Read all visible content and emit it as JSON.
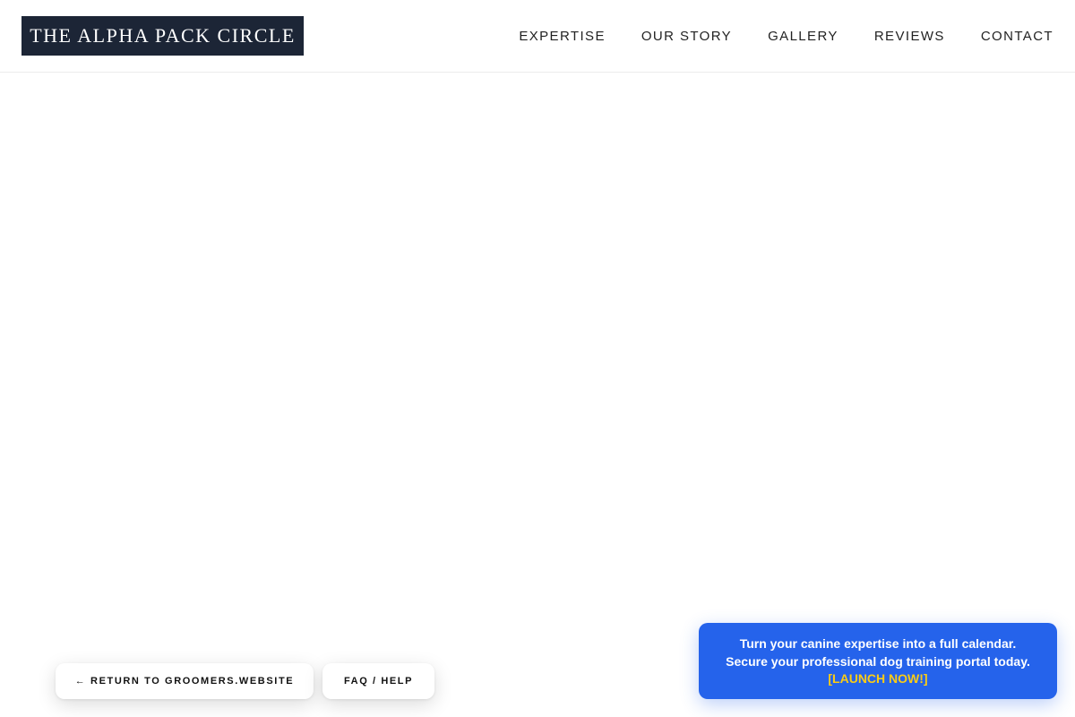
{
  "header": {
    "logo_text": "THE ALPHA PACK CIRCLE",
    "nav": [
      {
        "label": "EXPERTISE"
      },
      {
        "label": "OUR STORY"
      },
      {
        "label": "GALLERY"
      },
      {
        "label": "REVIEWS"
      },
      {
        "label": "CONTACT"
      }
    ]
  },
  "footer_buttons": {
    "return_label": "← RETURN TO GROOMERS.WEBSITE",
    "faq_label": "FAQ / HELP"
  },
  "promo": {
    "line1": "Turn your canine expertise into a full calendar.",
    "line2": "Secure your professional dog training portal today.",
    "cta": "[LAUNCH NOW!]"
  },
  "colors": {
    "logo_background": "#1c2536",
    "promo_background": "#2563eb",
    "promo_cta": "#facc15"
  }
}
